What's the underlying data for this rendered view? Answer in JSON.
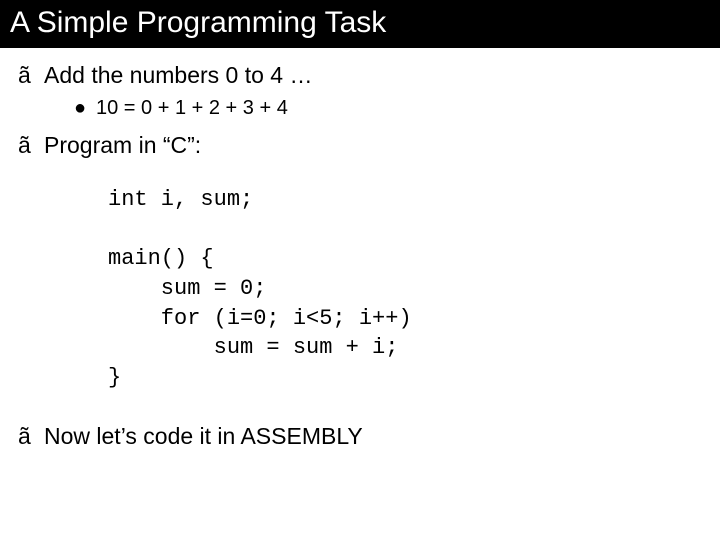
{
  "title": "A Simple Programming Task",
  "items": [
    {
      "bullet": "ã",
      "text": "Add the numbers 0 to 4 …"
    }
  ],
  "subitem": {
    "bullet": "●",
    "text": "10 = 0 + 1 + 2 + 3 + 4"
  },
  "items2": [
    {
      "bullet": "ã",
      "text": "Program in “C”:"
    }
  ],
  "code": "int i, sum;\n\nmain() {\n    sum = 0;\n    for (i=0; i<5; i++)\n        sum = sum + i;\n}",
  "items3": [
    {
      "bullet": "ã",
      "text": "Now let’s code it in ASSEMBLY"
    }
  ]
}
